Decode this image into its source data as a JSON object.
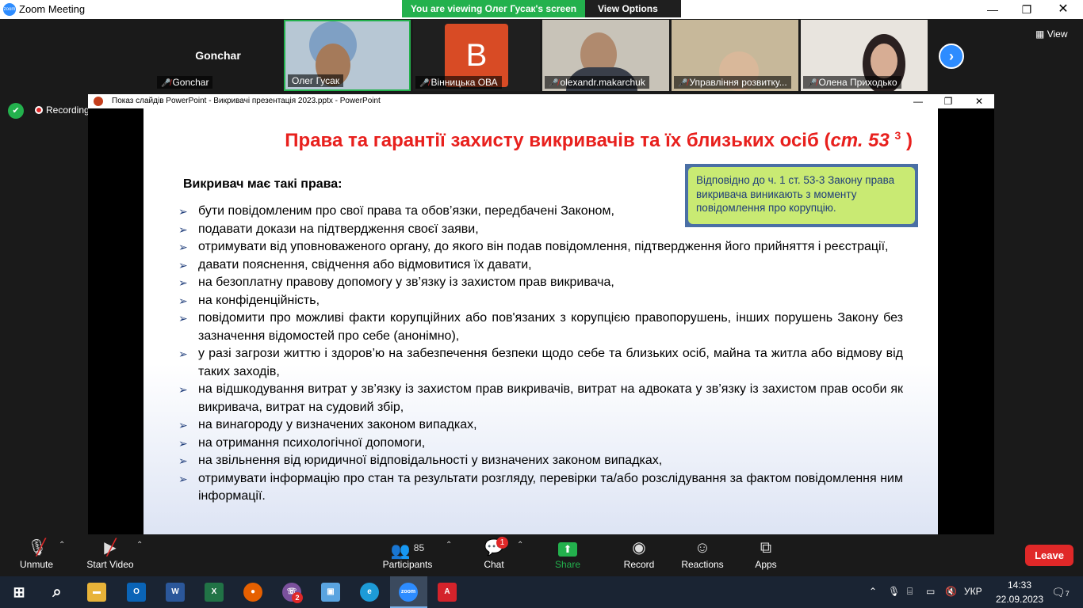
{
  "window": {
    "title": "Zoom Meeting",
    "app_icon": "zoom"
  },
  "banner": {
    "message": "You are viewing Олег Гусак's screen",
    "options": "View Options"
  },
  "gallery": {
    "tiles": [
      {
        "name": "Gonchar",
        "label": "Gonchar",
        "muted": true
      },
      {
        "name": "Олег Гусак",
        "muted": false
      },
      {
        "name": "Вінницька ОВА",
        "initial": "B",
        "muted": true
      },
      {
        "name": "olexandr.makarchuk",
        "muted": true
      },
      {
        "name": "Управління розвитку...",
        "muted": true
      },
      {
        "name": "Олена Приходько",
        "muted": true
      }
    ],
    "view_label": "View"
  },
  "recording": {
    "label": "Recording"
  },
  "ppt": {
    "title": "Показ слайдів PowerPoint  -  Викривачі презентація 2023.pptx - PowerPoint"
  },
  "slide": {
    "title": "Права та гарантії захисту викривачів та їх близьких осіб (",
    "title_ref": "ст. 53",
    "title_sup": "3",
    "title_end": " )",
    "callout": "Відповідно до ч. 1 ст. 53-3 Закону права викривача виникають з моменту повідомлення про корупцію.",
    "lead": "Викривач має такі права:",
    "rights": [
      "бути повідомленим про свої права та обов’язки, передбачені Законом,",
      "подавати докази на підтвердження своєї заяви,",
      "отримувати від уповноваженого органу, до якого він подав повідомлення, підтвердження його прийняття і реєстрації,",
      "давати пояснення, свідчення або відмовитися їх давати,",
      "на безоплатну правову допомогу у зв’язку із захистом прав викривача,",
      " на конфіденційність,",
      "повідомити про можливі факти корупційних або пов'язаних з корупцією правопорушень, інших порушень Закону без зазначення відомостей про себе (анонімно),",
      " у разі загрози життю і здоров’ю на забезпечення безпеки щодо себе та близьких осіб, майна та житла або відмову від таких заходів,",
      "на відшкодування витрат у зв’язку із захистом прав викривачів, витрат на адвоката у зв’язку із захистом прав особи як викривача, витрат на судовий збір,",
      "на винагороду у визначених законом випадках,",
      "на отримання психологічної допомоги,",
      "на звільнення від юридичної відповідальності у визначених законом випадках,",
      "отримувати інформацію про стан та результати розгляду, перевірки та/або розслідування за фактом повідомлення ним інформації."
    ]
  },
  "toolbar": {
    "unmute": "Unmute",
    "start_video": "Start Video",
    "participants": "Participants",
    "participants_count": "85",
    "chat": "Chat",
    "chat_badge": "1",
    "share_screen": "Share Screen",
    "record": "Record",
    "reactions": "Reactions",
    "apps": "Apps",
    "leave": "Leave"
  },
  "taskbar": {
    "lang": "УКР",
    "time": "14:33",
    "date": "22.09.2023",
    "notif_count": "7",
    "viber_badge": "2"
  },
  "colors": {
    "zoom_blue": "#2d8cff",
    "share_green": "#23b14d",
    "leave_red": "#e02828",
    "slide_title_red": "#e8201d",
    "callout_green": "#c9ea73"
  }
}
